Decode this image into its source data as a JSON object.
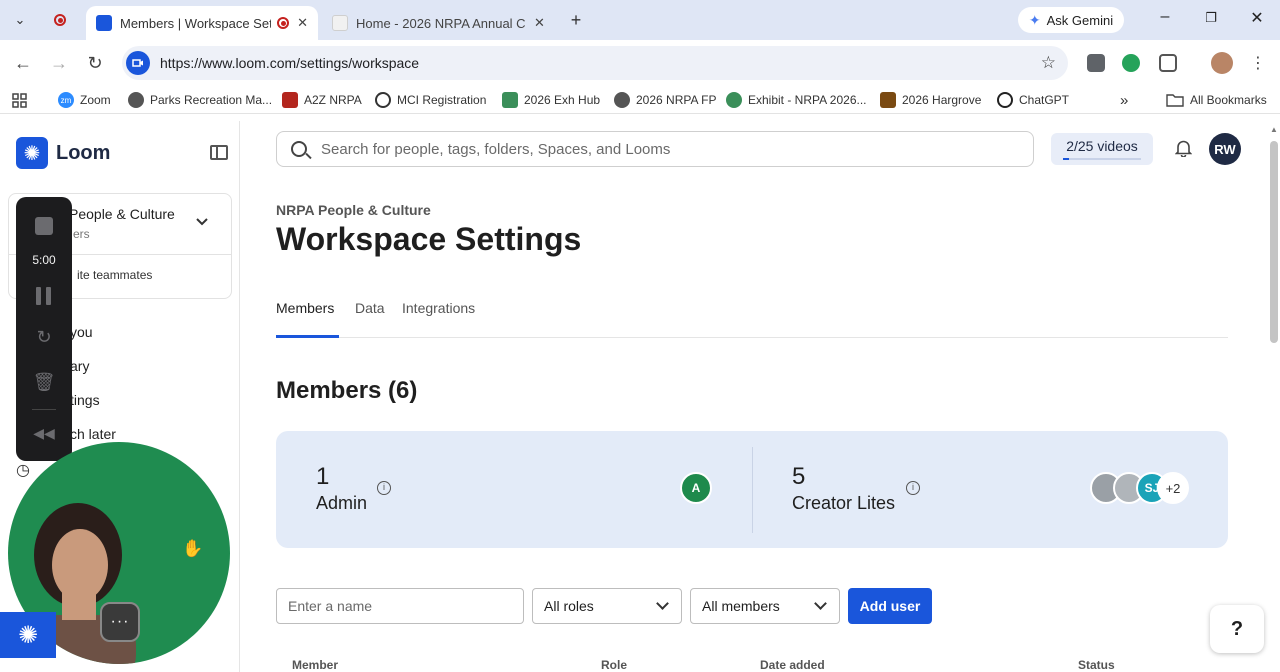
{
  "browser": {
    "tabs": [
      {
        "title": "Members | Workspace Setti",
        "active": true
      },
      {
        "title": "Home - 2026 NRPA Annual Con",
        "active": false
      }
    ],
    "new_tab": "+",
    "gemini_label": "Ask Gemini",
    "url": "https://www.loom.com/settings/workspace",
    "bookmarks": [
      "Zoom",
      "Parks Recreation Ma...",
      "A2Z NRPA",
      "MCI Registration",
      "2026 Exh Hub",
      "2026 NRPA FP",
      "Exhibit - NRPA 2026...",
      "2026 Hargrove",
      "ChatGPT"
    ],
    "all_bookmarks": "All Bookmarks",
    "overflow": "»"
  },
  "sidebar": {
    "brand": "Loom",
    "workspace_name": "People & Culture",
    "workspace_sub": "ers",
    "invite_label": "ite teammates",
    "links": [
      "you",
      "ary",
      "tings",
      "ch later"
    ]
  },
  "recorder": {
    "timer": "5:00",
    "more": "···"
  },
  "header": {
    "search_placeholder": "Search for people, tags, folders, Spaces, and Looms",
    "video_count": "2/25 videos",
    "video_progress": 0.08,
    "user_initials": "RW"
  },
  "main": {
    "org_name": "NRPA People & Culture",
    "title": "Workspace Settings",
    "tabs": [
      "Members",
      "Data",
      "Integrations"
    ],
    "members_heading": "Members (6)",
    "stats": [
      {
        "count": "1",
        "label": "Admin",
        "avatars": [
          "A"
        ]
      },
      {
        "count": "5",
        "label": "Creator Lites",
        "avatars": [
          "",
          "",
          "SJ"
        ],
        "extra": "+2"
      }
    ],
    "info_icon": "i",
    "filters": {
      "name_placeholder": "Enter a name",
      "roles": "All roles",
      "members": "All members",
      "add_user": "Add user"
    },
    "columns": [
      "Member",
      "Role",
      "Date added",
      "Status"
    ],
    "help": "?"
  },
  "colors": {
    "brand_blue": "#1a56db",
    "stats_bg": "#e3ebf8",
    "admin_avatar": "#1e8a4c",
    "sj_avatar": "#1aa3b8",
    "camera_bg": "#1f8c50"
  }
}
